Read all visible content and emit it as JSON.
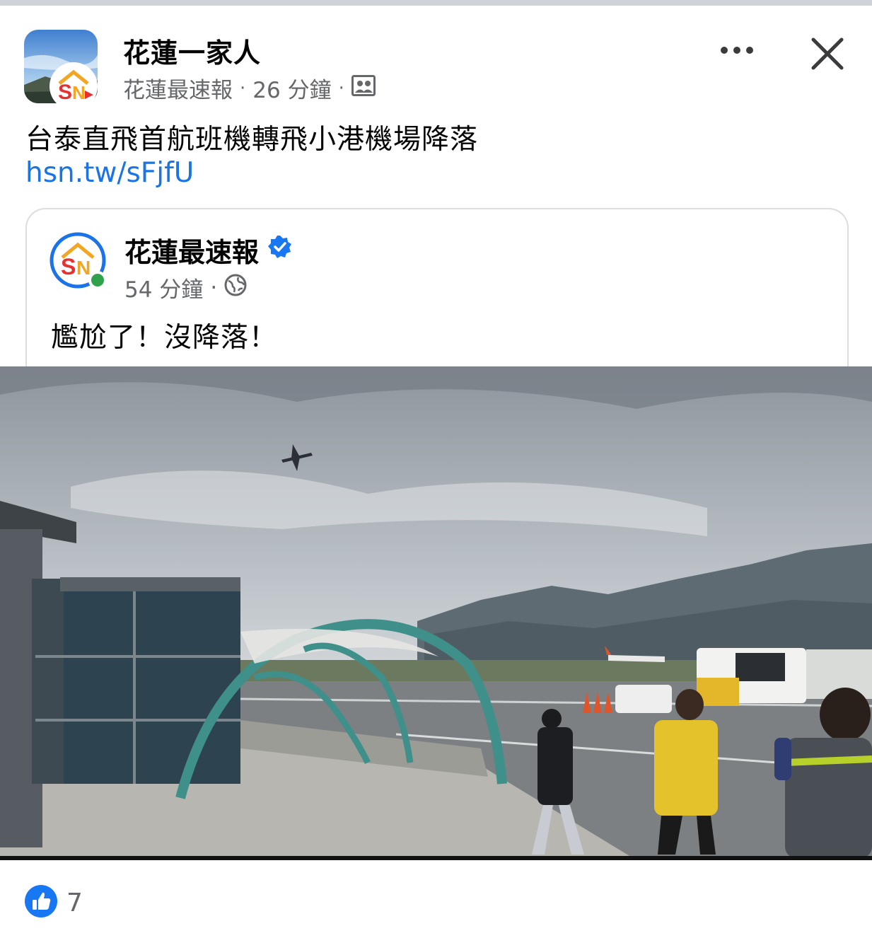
{
  "post": {
    "group_name": "花蓮一家人",
    "author": "花蓮最速報",
    "time": "26 分鐘",
    "separator": "·",
    "text": "台泰直飛首航班機轉飛小港機場降落",
    "link": "hsn.tw/sFjfU"
  },
  "shared_post": {
    "author": "花蓮最速報",
    "time": "54 分鐘",
    "separator": "·",
    "text": "尷尬了！沒降落！"
  },
  "reactions": {
    "like_count": "7"
  },
  "icons": {
    "more": "more-options-icon",
    "close": "close-icon",
    "audience": "group-audience-icon",
    "globe": "globe-icon",
    "verified": "verified-badge-icon",
    "like": "like-icon"
  },
  "colors": {
    "link": "#1b74e4",
    "meta": "#65676b",
    "verified": "#1877f2",
    "like": "#1877f2",
    "online": "#31a24c"
  }
}
